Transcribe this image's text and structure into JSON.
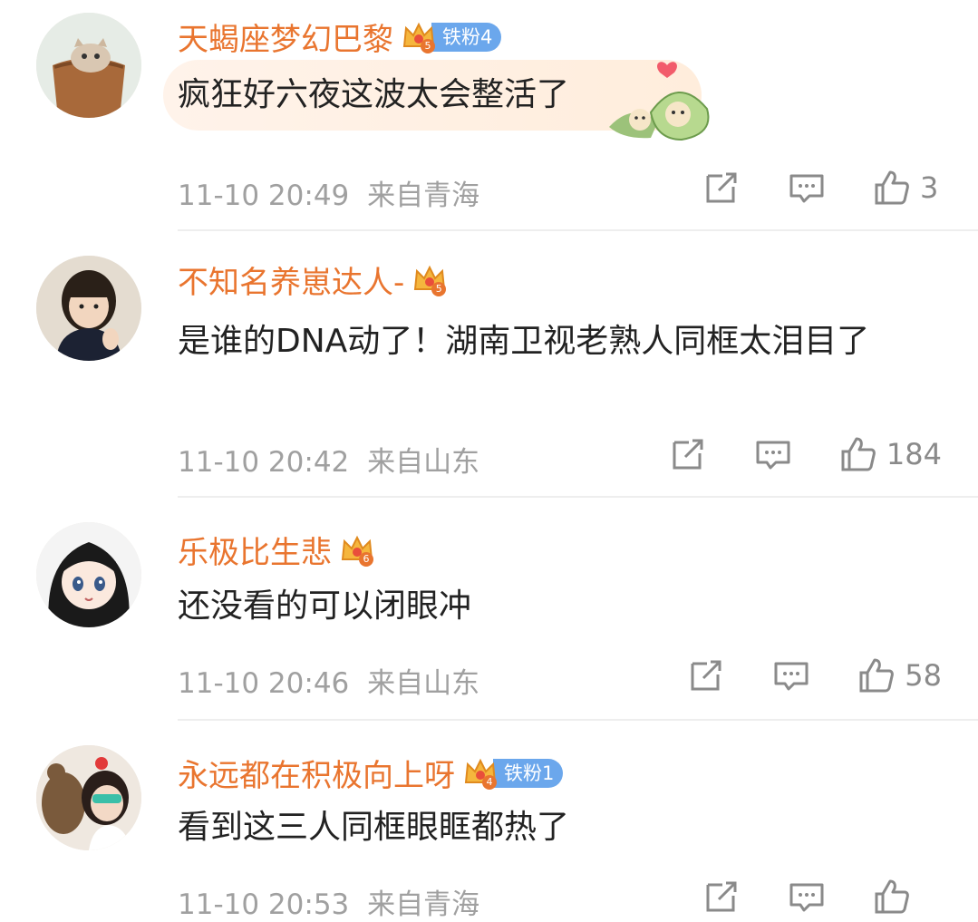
{
  "comments": [
    {
      "username": "天蝎座梦幻巴黎",
      "crown_level": "5",
      "fan_badge": "铁粉4",
      "text": "疯狂好六夜这波太会整活了",
      "time": "11-10 20:49",
      "location": "来自青海",
      "likes": "3",
      "avatar": "cat-in-basket",
      "sticker": "zongzi-sticker"
    },
    {
      "username": "不知名养崽达人-",
      "crown_level": "5",
      "fan_badge": "",
      "text": "是谁的DNA动了！湖南卫视老熟人同框太泪目了",
      "time": "11-10 20:42",
      "location": "来自山东",
      "likes": "184",
      "avatar": "child-photo"
    },
    {
      "username": "乐极比生悲",
      "crown_level": "6",
      "fan_badge": "",
      "text": "还没看的可以闭眼冲",
      "time": "11-10 20:46",
      "location": "来自山东",
      "likes": "58",
      "avatar": "anime-girl"
    },
    {
      "username": "永远都在积极向上呀",
      "crown_level": "4",
      "fan_badge": "铁粉1",
      "text": "看到这三人同框眼眶都热了",
      "time": "11-10 20:53",
      "location": "来自青海",
      "likes": "",
      "avatar": "girl-with-teddy-bear"
    }
  ],
  "icons": {
    "share": "share-icon",
    "reply": "comment-icon",
    "like": "thumbs-up-icon",
    "member": "crown-icon"
  },
  "colors": {
    "username": "#e9752f",
    "fan_badge": "#6ba7ec",
    "meta": "#a0a0a0",
    "text": "#222222"
  }
}
